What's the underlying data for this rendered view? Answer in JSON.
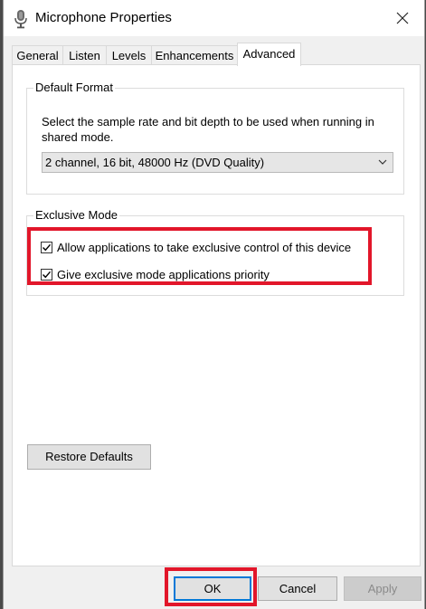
{
  "window": {
    "title": "Microphone Properties",
    "icon": "microphone-icon",
    "close_icon": "close-icon"
  },
  "tabs": [
    {
      "label": "General",
      "active": false
    },
    {
      "label": "Listen",
      "active": false
    },
    {
      "label": "Levels",
      "active": false
    },
    {
      "label": "Enhancements",
      "active": false
    },
    {
      "label": "Advanced",
      "active": true
    }
  ],
  "default_format": {
    "group_label": "Default Format",
    "description": "Select the sample rate and bit depth to be used when running in shared mode.",
    "selected": "2 channel, 16 bit, 48000 Hz (DVD Quality)"
  },
  "exclusive_mode": {
    "group_label": "Exclusive Mode",
    "options": [
      {
        "label": "Allow applications to take exclusive control of this device",
        "checked": true
      },
      {
        "label": "Give exclusive mode applications priority",
        "checked": true
      }
    ]
  },
  "buttons": {
    "restore_defaults": "Restore Defaults",
    "ok": "OK",
    "cancel": "Cancel",
    "apply": "Apply"
  },
  "colors": {
    "highlight": "#e2162a",
    "default_button_border": "#0078d7"
  }
}
